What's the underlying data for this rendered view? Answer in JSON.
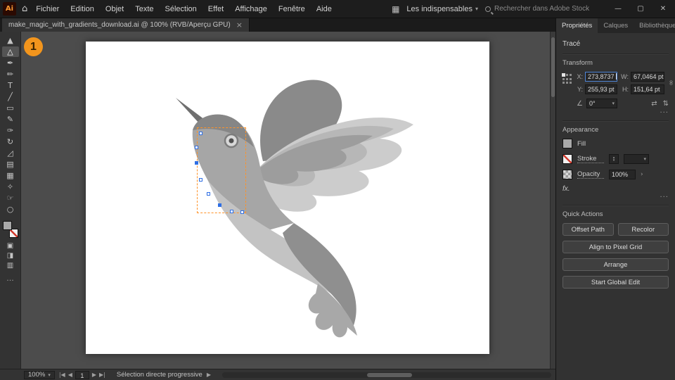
{
  "menubar": {
    "logo": "Ai",
    "home_icon": "⌂",
    "items": [
      "Fichier",
      "Edition",
      "Objet",
      "Texte",
      "Sélection",
      "Effet",
      "Affichage",
      "Fenêtre",
      "Aide"
    ],
    "workspace_icon": "▦",
    "workspace_label": "Les indispensables",
    "workspace_chevron": "▾",
    "search_placeholder": "Rechercher dans Adobe Stock",
    "window": {
      "minimize": "—",
      "maximize": "▢",
      "close": "✕"
    }
  },
  "tabbar": {
    "doc_tab": "make_magic_with_gradients_download.ai @ 100% (RVB/Aperçu GPU)",
    "close_icon": "×"
  },
  "annotation_badge": "1",
  "toolbar": {
    "tools": [
      {
        "name": "selection-tool",
        "glyph": "▲"
      },
      {
        "name": "direct-selection-tool",
        "glyph": "△"
      },
      {
        "name": "pen-tool",
        "glyph": "✒"
      },
      {
        "name": "curvature-tool",
        "glyph": "✏"
      },
      {
        "name": "type-tool",
        "glyph": "T"
      },
      {
        "name": "line-segment-tool",
        "glyph": "╱"
      },
      {
        "name": "rectangle-tool",
        "glyph": "▭"
      },
      {
        "name": "paintbrush-tool",
        "glyph": "✎"
      },
      {
        "name": "pencil-tool",
        "glyph": "✑"
      },
      {
        "name": "rotate-tool",
        "glyph": "↻"
      },
      {
        "name": "scale-tool",
        "glyph": "◿"
      },
      {
        "name": "gradient-tool",
        "glyph": "▤"
      },
      {
        "name": "mesh-tool",
        "glyph": "▦"
      },
      {
        "name": "eyedropper-tool",
        "glyph": "✧"
      },
      {
        "name": "hand-tool",
        "glyph": "☞"
      },
      {
        "name": "zoom-tool",
        "glyph": "○"
      }
    ],
    "draw_modes": [
      "▣",
      "◨",
      "▥"
    ],
    "more_icon": "···"
  },
  "panel": {
    "tabs": [
      "Propriétés",
      "Calques",
      "Bibliothèques"
    ],
    "selection_type": "Tracé",
    "transform": {
      "title": "Transform",
      "x_label": "X:",
      "x_value": "273,8737",
      "y_label": "Y:",
      "y_value": "255,93 pt",
      "w_label": "W:",
      "w_value": "67,0464 pt",
      "h_label": "H:",
      "h_value": "151,64 pt",
      "angle_icon": "∠",
      "angle_value": "0°",
      "link_icon": "∞",
      "flip_h_icon": "⇄",
      "flip_v_icon": "⇅",
      "more_icon": "···"
    },
    "appearance": {
      "title": "Appearance",
      "fill_label": "Fill",
      "stroke_label": "Stroke",
      "stepper_up": "▴",
      "stepper_down": "▾",
      "dropdown_chevron": "▾",
      "opacity_label": "Opacity",
      "opacity_value": "100%",
      "opacity_chevron": "›",
      "fx_label": "fx.",
      "more_icon": "···"
    },
    "quick_actions": {
      "title": "Quick Actions",
      "buttons": [
        "Offset Path",
        "Recolor",
        "Align to Pixel Grid",
        "Arrange",
        "Start Global Edit"
      ]
    }
  },
  "statusbar": {
    "zoom": "100%",
    "zoom_chevron": "▾",
    "nav": {
      "first": "|◀",
      "prev": "◀",
      "next": "▶",
      "last": "▶|"
    },
    "artboard_field": "1",
    "tool_hint": "Sélection directe progressive",
    "hint_arrow": "▶"
  },
  "colors": {
    "accent_orange": "#f2951d",
    "selection_blue": "#2f6fe4",
    "selection_marquee": "#ff9228"
  }
}
